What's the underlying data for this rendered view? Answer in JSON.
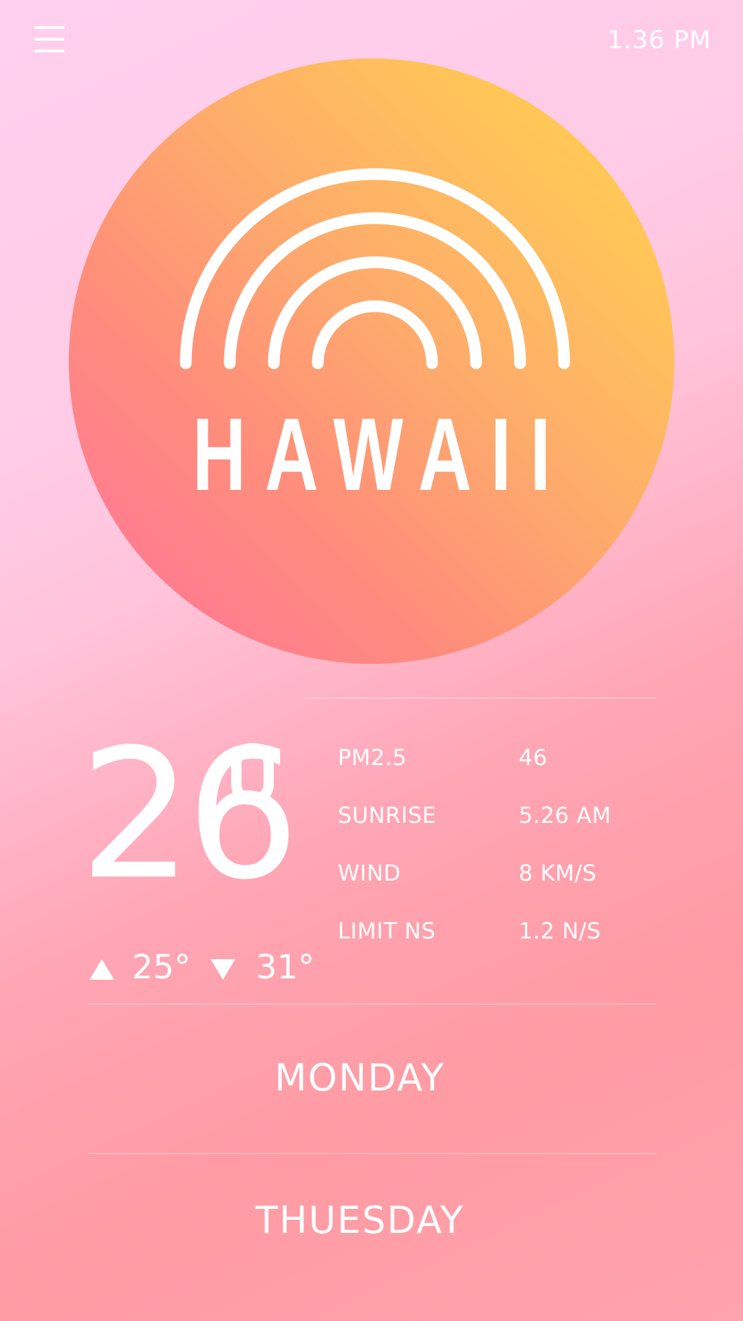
{
  "status": {
    "time": "1.36 PM"
  },
  "location": {
    "city": "HAWAII"
  },
  "weather": {
    "temperature": "26",
    "low": "25°",
    "high": "31°"
  },
  "stats": [
    {
      "label": "PM2.5",
      "value": "46"
    },
    {
      "label": "SUNRISE",
      "value": "5.26 AM"
    },
    {
      "label": "WIND",
      "value": "8 KM/S"
    },
    {
      "label": "LIMIT NS",
      "value": "1.2 N/S"
    }
  ],
  "forecast": {
    "days": [
      "MONDAY",
      "THUESDAY"
    ]
  },
  "colors": {
    "circle_top": "#ffd44e",
    "circle_bottom": "#ff7a90",
    "background": "#ffa5b4"
  },
  "icons": {
    "menu": "hamburger-menu-icon",
    "weather": "rainbow-icon",
    "low_indicator": "triangle-up-icon",
    "high_indicator": "triangle-down-icon"
  }
}
